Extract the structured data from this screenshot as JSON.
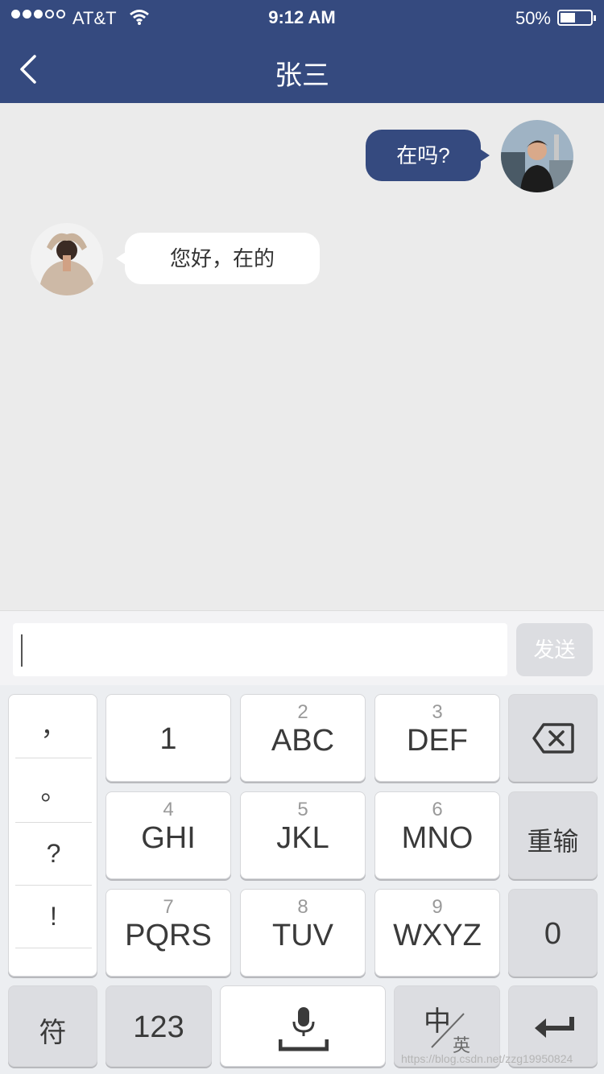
{
  "status_bar": {
    "carrier": "AT&T",
    "time": "9:12 AM",
    "battery_percent": "50%",
    "battery_level": 0.5
  },
  "nav": {
    "title": "张三",
    "back_icon": "chevron-left-icon"
  },
  "colors": {
    "header_bg": "#354a7f",
    "bubble_sent": "#354a7f",
    "bubble_received": "#ffffff",
    "chat_bg": "#ebebeb"
  },
  "messages": [
    {
      "side": "right",
      "text": "在吗?"
    },
    {
      "side": "left",
      "text": "您好，在的"
    }
  ],
  "composer": {
    "input_value": "",
    "send_label": "发送"
  },
  "keyboard": {
    "symbols": [
      "，",
      "。",
      "?",
      "!"
    ],
    "keys": [
      {
        "sub": "",
        "main": "1"
      },
      {
        "sub": "2",
        "main": "ABC"
      },
      {
        "sub": "3",
        "main": "DEF"
      },
      {
        "sub": "4",
        "main": "GHI"
      },
      {
        "sub": "5",
        "main": "JKL"
      },
      {
        "sub": "6",
        "main": "MNO"
      },
      {
        "sub": "7",
        "main": "PQRS"
      },
      {
        "sub": "8",
        "main": "TUV"
      },
      {
        "sub": "9",
        "main": "WXYZ"
      }
    ],
    "delete_icon": "backspace-icon",
    "retype": "重输",
    "zero": "0",
    "symbol_key": "符",
    "numeric_key": "123",
    "space_icon": "microphone-space-icon",
    "lang_main": "中",
    "lang_sub": "英",
    "enter_icon": "return-icon"
  },
  "watermark": "https://blog.csdn.net/zzg19950824"
}
